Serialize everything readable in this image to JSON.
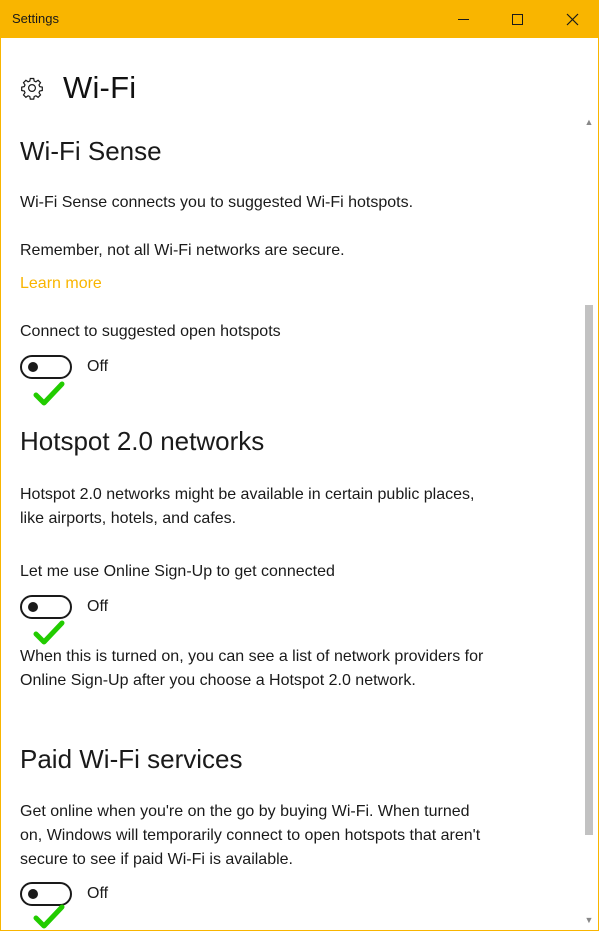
{
  "window": {
    "title": "Settings",
    "minimize_label": "Minimize",
    "maximize_label": "Maximize",
    "close_label": "Close"
  },
  "page": {
    "title": "Wi-Fi",
    "icon": "gear-icon"
  },
  "wifi_sense": {
    "heading": "Wi-Fi Sense",
    "description": "Wi-Fi Sense connects you to suggested Wi-Fi hotspots.",
    "warning": "Remember, not all Wi-Fi networks are secure.",
    "learn_more": "Learn more",
    "setting_label": "Connect to suggested open hotspots",
    "toggle_state": "Off"
  },
  "hotspot20": {
    "heading": "Hotspot 2.0 networks",
    "description_line1": "Hotspot 2.0 networks might be available in certain public places,",
    "description_line2": "like airports, hotels, and cafes.",
    "setting_label": "Let me use Online Sign-Up to get connected",
    "toggle_state": "Off",
    "note_line1": "When this is turned on, you can see a list of network providers for",
    "note_line2": "Online Sign-Up after you choose a Hotspot 2.0 network."
  },
  "paid_wifi": {
    "heading": "Paid Wi-Fi services",
    "description_line1": "Get online when you're on the go by buying Wi-Fi. When turned",
    "description_line2": "on, Windows will temporarily connect to open hotspots that aren't",
    "description_line3": "secure to see if paid Wi-Fi is available.",
    "toggle_state": "Off"
  },
  "colors": {
    "accent": "#f9b500",
    "check_mark": "#22cc00",
    "text": "#1a1a1a"
  }
}
